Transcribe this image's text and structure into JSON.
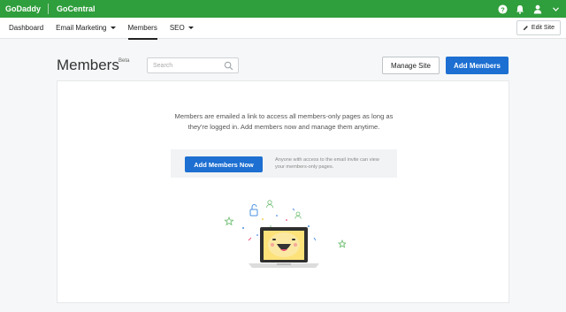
{
  "topbar": {
    "brand": "GoDaddy",
    "product": "GoCentral",
    "color": "#2f9e3c",
    "icons": [
      "help-icon",
      "bell-icon",
      "user-icon",
      "chevron-down-icon"
    ]
  },
  "nav": {
    "items": [
      {
        "label": "Dashboard",
        "has_dropdown": false,
        "active": false
      },
      {
        "label": "Email Marketing",
        "has_dropdown": true,
        "active": false
      },
      {
        "label": "Members",
        "has_dropdown": false,
        "active": true
      },
      {
        "label": "SEO",
        "has_dropdown": true,
        "active": false
      }
    ],
    "edit_site_label": "Edit Site"
  },
  "header": {
    "title": "Members",
    "badge": "Beta",
    "search_placeholder": "Search",
    "manage_site_label": "Manage Site",
    "add_members_label": "Add Members",
    "accent": "#1d6fd1"
  },
  "card": {
    "description_line1": "Members are emailed a link to access all members-only pages as long as",
    "description_line2": "they're logged in. Add members now and manage them anytime.",
    "cta_label": "Add Members Now",
    "cta_note_line1": "Anyone with access to the email invite can view",
    "cta_note_line2": "your members-only pages."
  }
}
